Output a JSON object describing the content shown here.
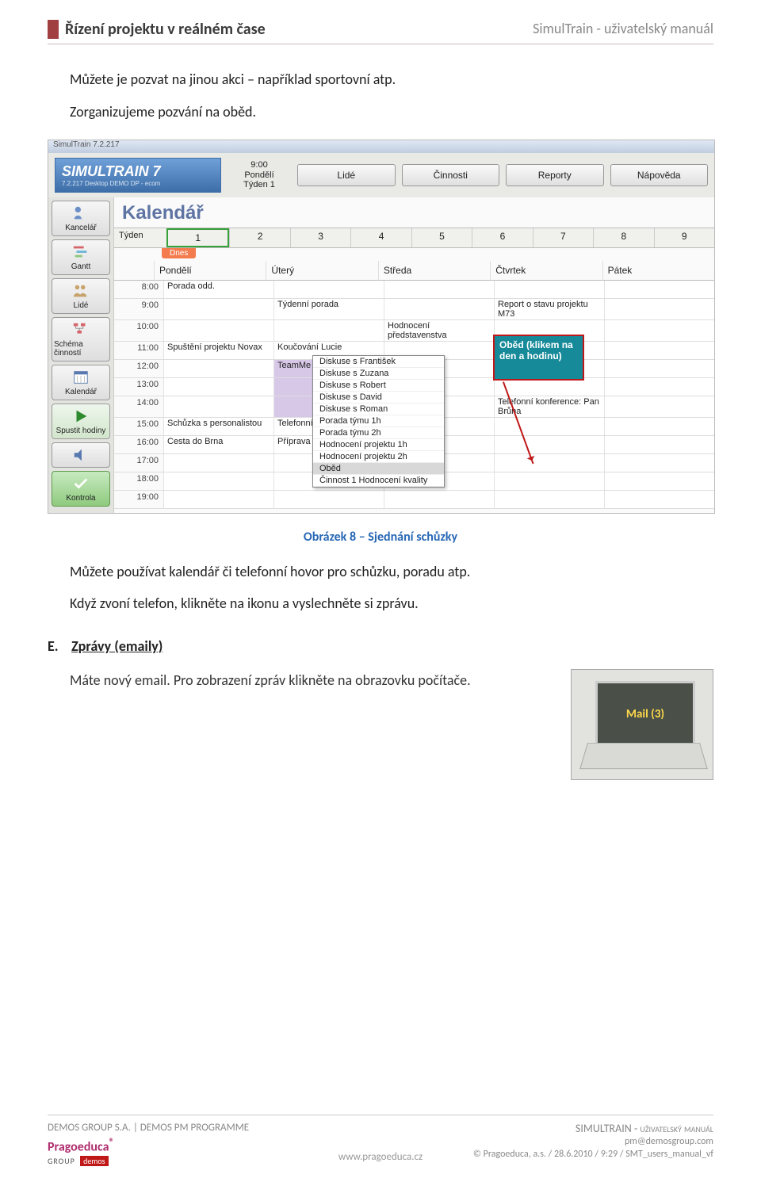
{
  "header": {
    "left": "Řízení projektu v reálném čase",
    "right": "SimulTrain - uživatelský manuál"
  },
  "text": {
    "p1": "Můžete je pozvat na jinou akci – například sportovní atp.",
    "p2": "Zorganizujeme pozvání na oběd.",
    "caption": "Obrázek 8 – Sjednání schůzky",
    "p3": "Můžete používat kalendář či telefonní hovor pro schůzku, poradu atp.",
    "p4": "Když zvoní telefon, klikněte na ikonu a vyslechněte si zprávu.",
    "section_letter": "E.",
    "section_title": "Zprávy (emaily)",
    "email_para": "Máte nový email. Pro zobrazení zpráv klikněte na obrazovku počítače.",
    "mail_badge": "Mail (3)"
  },
  "shot": {
    "title_strip": "SimulTrain 7.2.217",
    "logo": "SIMULTRAIN 7",
    "logo_sub": "7.2.217 Desktop DEMO DP - ecom",
    "today": {
      "time": "9:00",
      "day": "Pondělí",
      "week": "Týden 1"
    },
    "hdr_buttons": [
      "Lidé",
      "Činnosti",
      "Reporty",
      "Nápověda"
    ],
    "sidebar": [
      "Kancelář",
      "Gantt",
      "Lidé",
      "Schéma činností",
      "Kalendář",
      "Spustit hodiny",
      "Kontrola"
    ],
    "main_title": "Kalendář",
    "week_label": "Týden",
    "weeks": [
      "1",
      "2",
      "3",
      "4",
      "5",
      "6",
      "7",
      "8",
      "9"
    ],
    "dnes": "Dnes",
    "days": [
      "Pondělí",
      "Úterý",
      "Středa",
      "Čtvrtek",
      "Pátek"
    ],
    "hours": [
      "8:00",
      "9:00",
      "10:00",
      "11:00",
      "12:00",
      "13:00",
      "14:00",
      "15:00",
      "16:00",
      "17:00",
      "18:00",
      "19:00"
    ],
    "events": {
      "mon_8": "Porada odd.",
      "mon_11": "Spuštění projektu Novax",
      "mon_15": "Schůzka s personalistou",
      "mon_16": "Cesta do Brna",
      "tue_9": "Týdenní porada",
      "tue_11": "Koučování Lucie",
      "tue_12": "TeamMe",
      "tue_15": "Telefonní Matyáš",
      "tue_16": "Příprava",
      "wed_10": "Hodnocení představenstva",
      "thu_9": "Report o stavu projektu M73",
      "thu_14": "Telefonní konference: Pan Brůna",
      "popup": "Oběd (klikem na den a hodinu)"
    },
    "dropdown": [
      "Diskuse s František",
      "Diskuse s Zuzana",
      "Diskuse s Robert",
      "Diskuse s David",
      "Diskuse s Roman",
      "Porada týmu 1h",
      "Porada týmu 2h",
      "Hodnocení projektu 1h",
      "Hodnocení projektu 2h",
      "Oběd",
      "Činnost 1 Hodnocení kvality"
    ]
  },
  "footer": {
    "line1": "DEMOS GROUP S.A. | DEMOS PM PROGRAMME",
    "brand": "Pragoeduca",
    "demos": "demos",
    "right_top": "SIMULTRAIN - uživatelský manuál",
    "right_email": "pm@demosgroup.com",
    "right_meta": "© Pragoeduca, a.s. / 28.6.2010 / 9:29 / SMT_users_manual_vf",
    "center": "www.pragoeduca.cz"
  }
}
